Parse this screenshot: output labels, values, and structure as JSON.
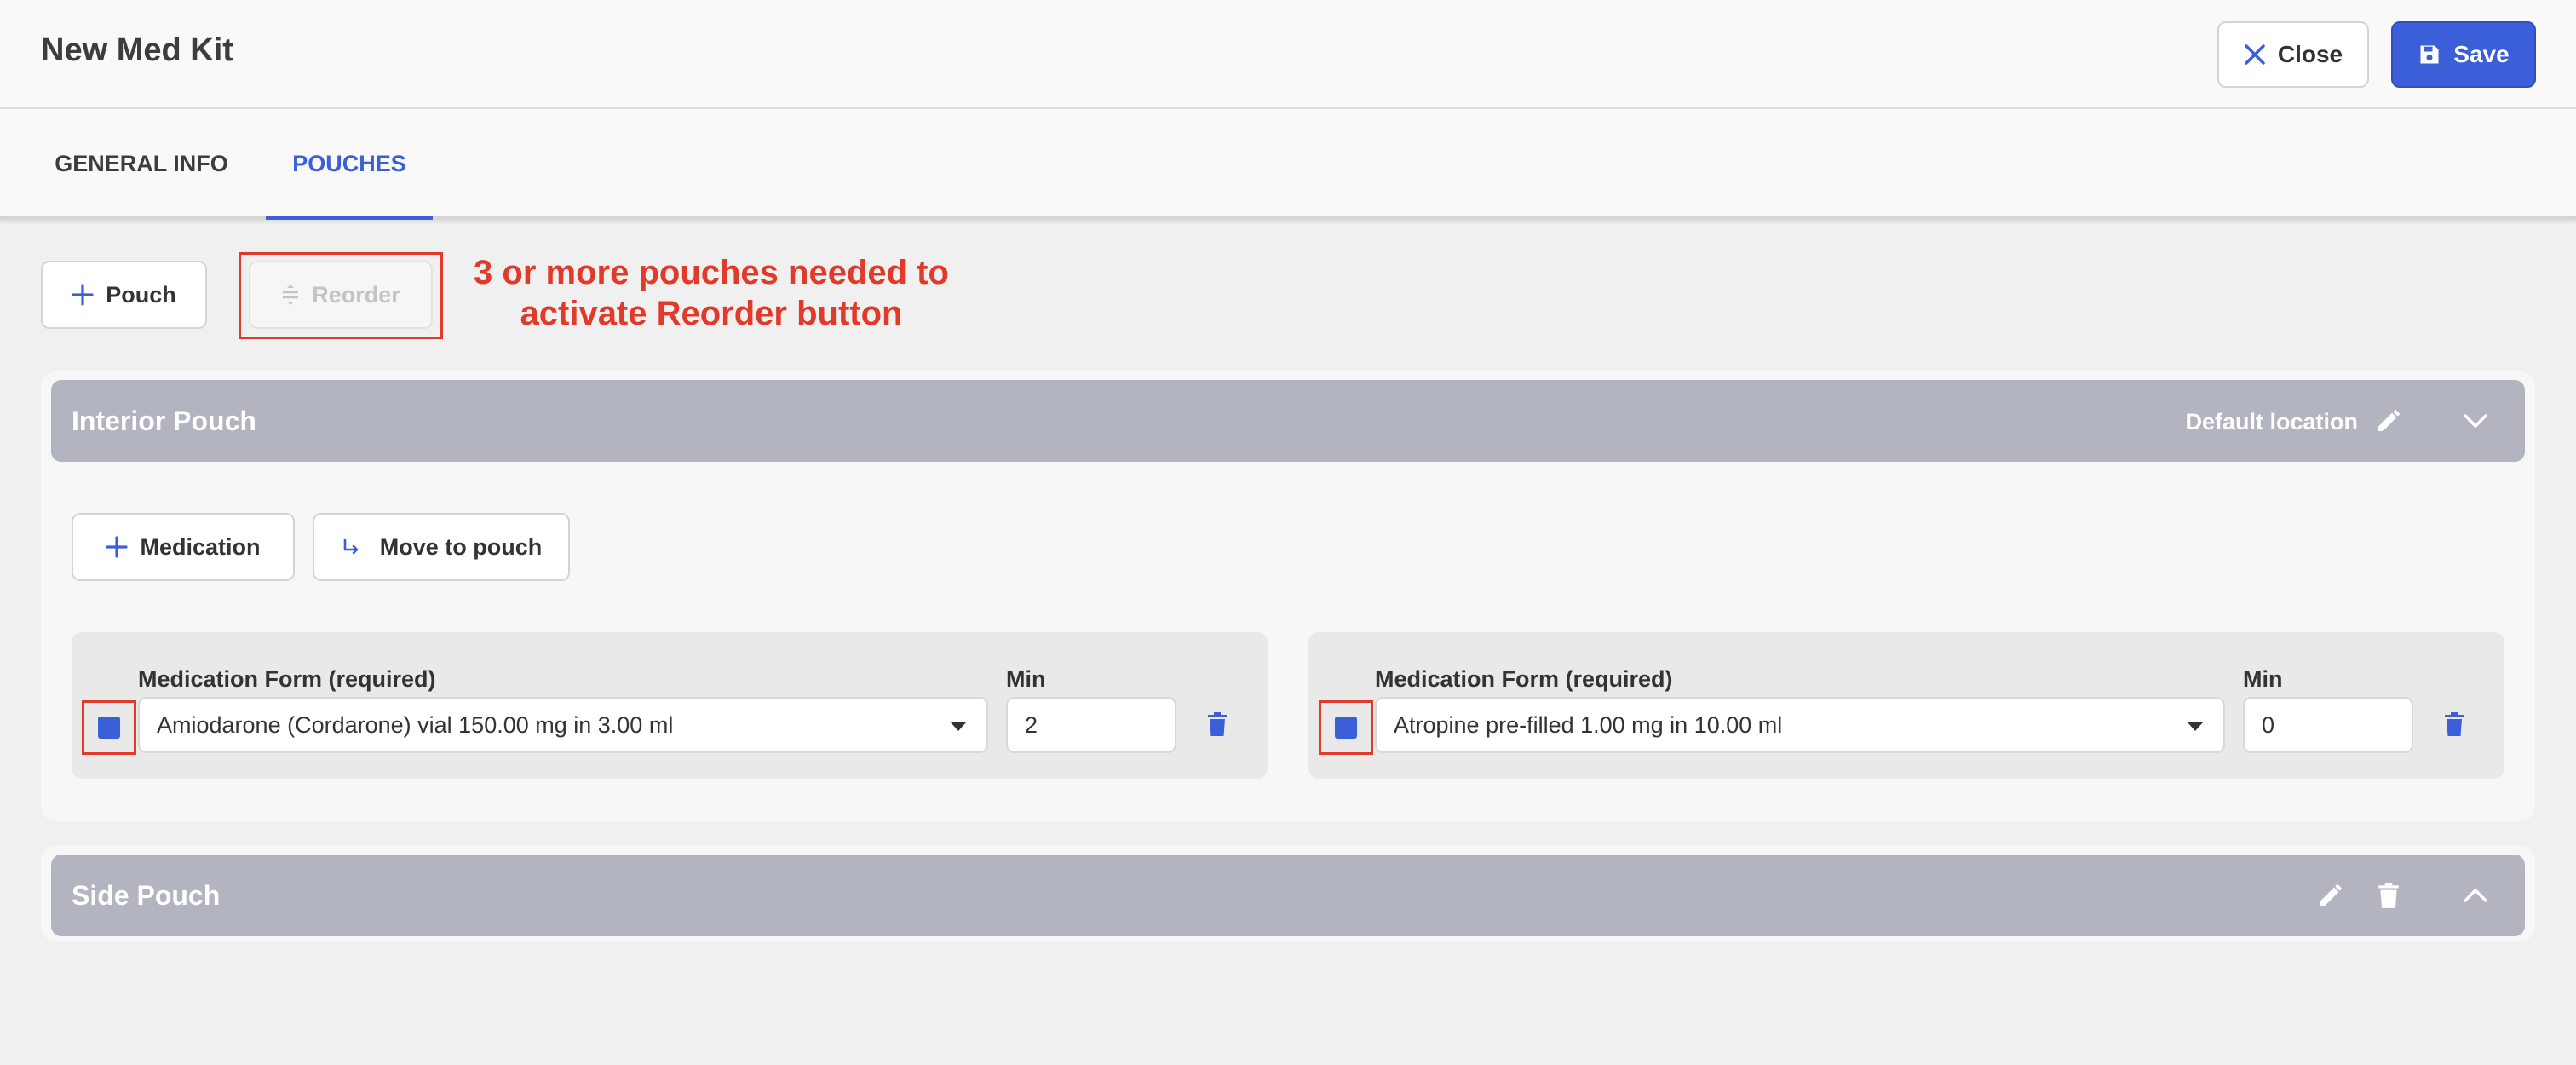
{
  "header": {
    "title": "New Med Kit",
    "close_label": "Close",
    "save_label": "Save"
  },
  "tabs": [
    {
      "label": "GENERAL INFO",
      "active": false
    },
    {
      "label": "POUCHES",
      "active": true
    }
  ],
  "toolbar": {
    "pouch_label": "Pouch",
    "reorder_label": "Reorder",
    "reorder_enabled": false
  },
  "annotation": {
    "line1": "3 or more pouches needed to",
    "line2": "activate Reorder button"
  },
  "pouches": [
    {
      "title": "Interior Pouch",
      "location": "Default location",
      "expanded": true,
      "add_medication_label": "Medication",
      "move_to_pouch_label": "Move to pouch",
      "medications": [
        {
          "form_label": "Medication Form (required)",
          "form_value": "Amiodarone (Cordarone) vial 150.00 mg in 3.00 ml",
          "min_label": "Min",
          "min_value": "2",
          "checked": true
        },
        {
          "form_label": "Medication Form (required)",
          "form_value": "Atropine pre-filled 1.00 mg in 10.00 ml",
          "min_label": "Min",
          "min_value": "0",
          "checked": true
        }
      ]
    },
    {
      "title": "Side Pouch",
      "expanded": false
    }
  ],
  "colors": {
    "accent": "#3b5fd9",
    "annotation": "#e03a2a",
    "pouch_bar": "#b2b5c0"
  }
}
